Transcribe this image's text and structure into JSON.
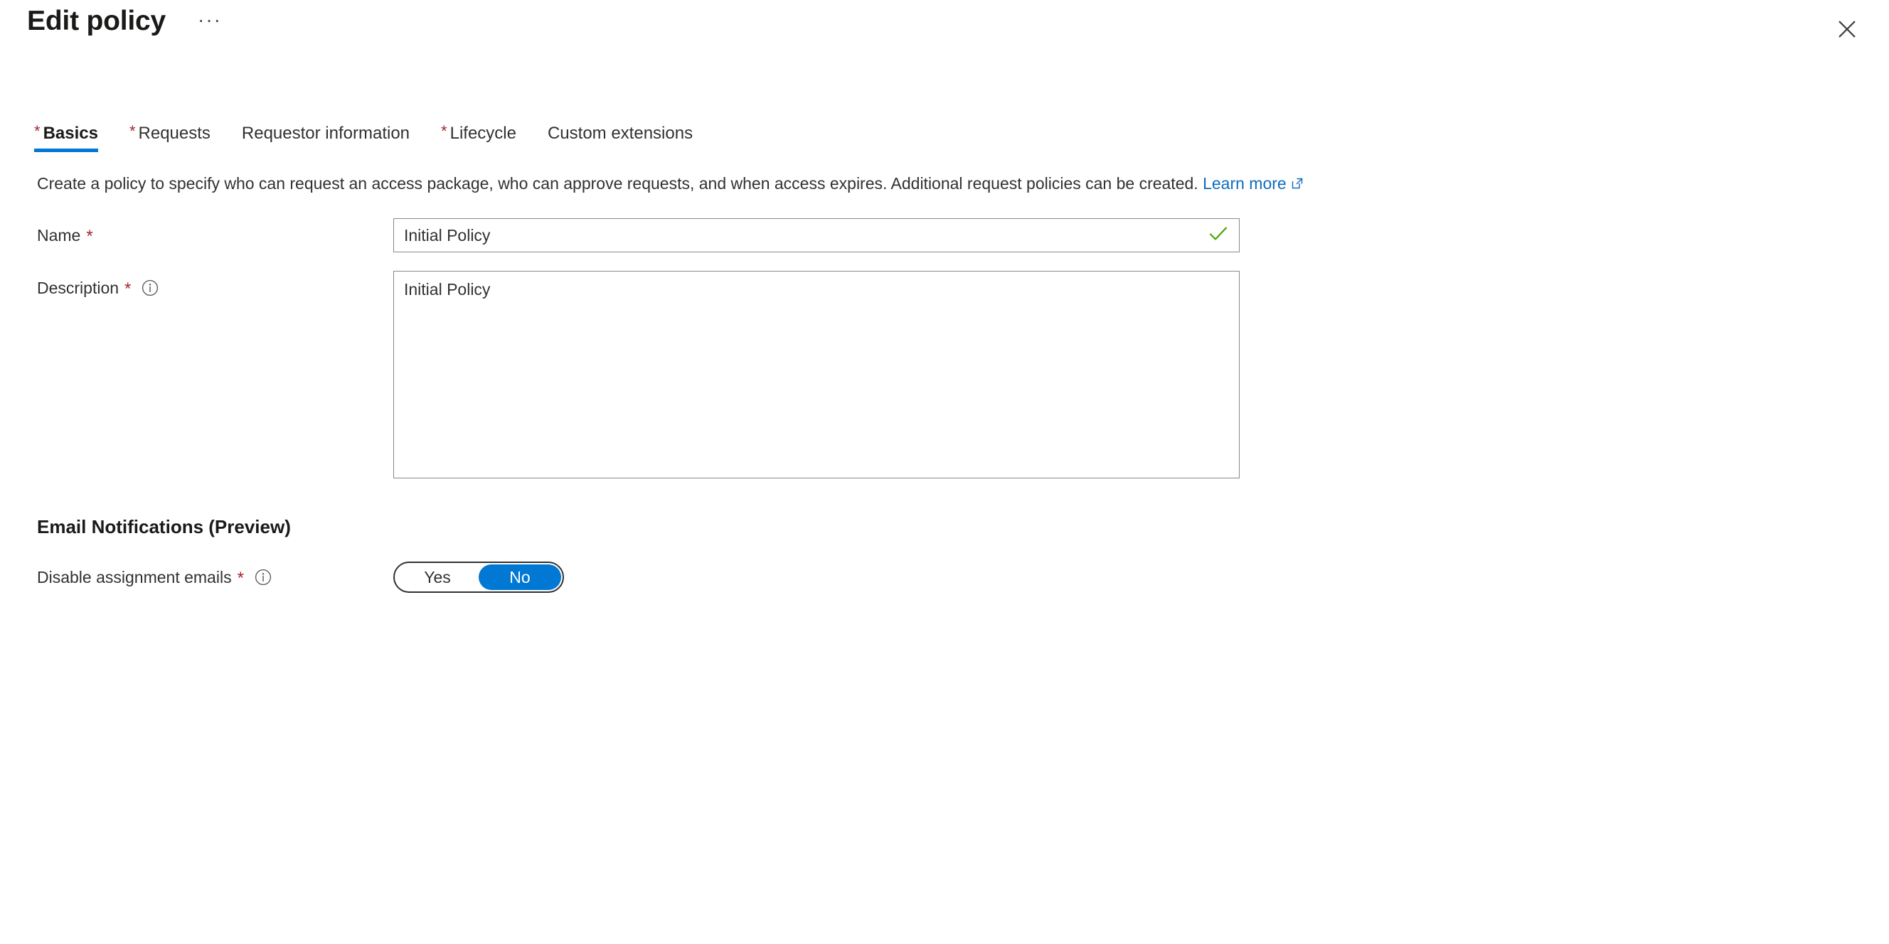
{
  "header": {
    "title": "Edit policy",
    "more_label": "···",
    "close_icon": "close-icon",
    "more_icon": "ellipsis-icon"
  },
  "tabs": [
    {
      "label": "Basics",
      "required": true,
      "selected": true
    },
    {
      "label": "Requests",
      "required": true,
      "selected": false
    },
    {
      "label": "Requestor information",
      "required": false,
      "selected": false
    },
    {
      "label": "Lifecycle",
      "required": true,
      "selected": false
    },
    {
      "label": "Custom extensions",
      "required": false,
      "selected": false
    }
  ],
  "intro": {
    "text": "Create a policy to specify who can request an access package, who can approve requests, and when access expires. Additional request policies can be created.",
    "link_label": "Learn more",
    "link_icon": "external-link-icon"
  },
  "form": {
    "name": {
      "label": "Name",
      "required_marker": "*",
      "value": "Initial Policy",
      "placeholder": "",
      "validation_icon": "checkmark-icon",
      "validation_color": "#4ca302"
    },
    "description": {
      "label": "Description",
      "required_marker": "*",
      "info_icon": "info-icon",
      "value": "Initial Policy",
      "placeholder": ""
    }
  },
  "email_notifications": {
    "heading": "Email Notifications (Preview)",
    "disable_assignment_emails": {
      "label": "Disable assignment emails",
      "required_marker": "*",
      "info_icon": "info-icon",
      "options": [
        "Yes",
        "No"
      ],
      "selected": "No"
    }
  },
  "colors": {
    "accent": "#0078d4",
    "link": "#0f6cbd",
    "required": "#a4262c",
    "success": "#4ca302",
    "text": "#323130",
    "border": "#8a8886"
  }
}
